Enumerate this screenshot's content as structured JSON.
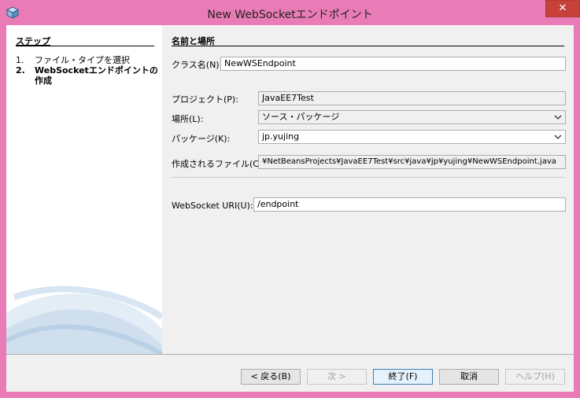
{
  "window": {
    "title": "New WebSocketエンドポイント",
    "close": "✕"
  },
  "steps": {
    "title": "ステップ",
    "items": [
      {
        "num": "1.",
        "label": "ファイル・タイプを選択"
      },
      {
        "num": "2.",
        "label": "WebSocketエンドポイントの作成"
      }
    ]
  },
  "form": {
    "section_title": "名前と場所",
    "class_name_label": "クラス名(N):",
    "class_name_value": "NewWSEndpoint",
    "project_label": "プロジェクト(P):",
    "project_value": "JavaEE7Test",
    "location_label": "場所(L):",
    "location_value": "ソース・パッケージ",
    "package_label": "パッケージ(K):",
    "package_value": "jp.yujing",
    "created_file_label": "作成されるファイル(C):",
    "created_file_value": "¥NetBeansProjects¥JavaEE7Test¥src¥java¥jp¥yujing¥NewWSEndpoint.java",
    "uri_label": "WebSocket URI(U):",
    "uri_value": "/endpoint"
  },
  "buttons": {
    "back": "< 戻る(B)",
    "next": "次 >",
    "finish": "終了(F)",
    "cancel": "取消",
    "help": "ヘルプ(H)"
  },
  "colors": {
    "frame": "#e97cb6",
    "close": "#c7413a",
    "client": "#f0f0f0"
  }
}
